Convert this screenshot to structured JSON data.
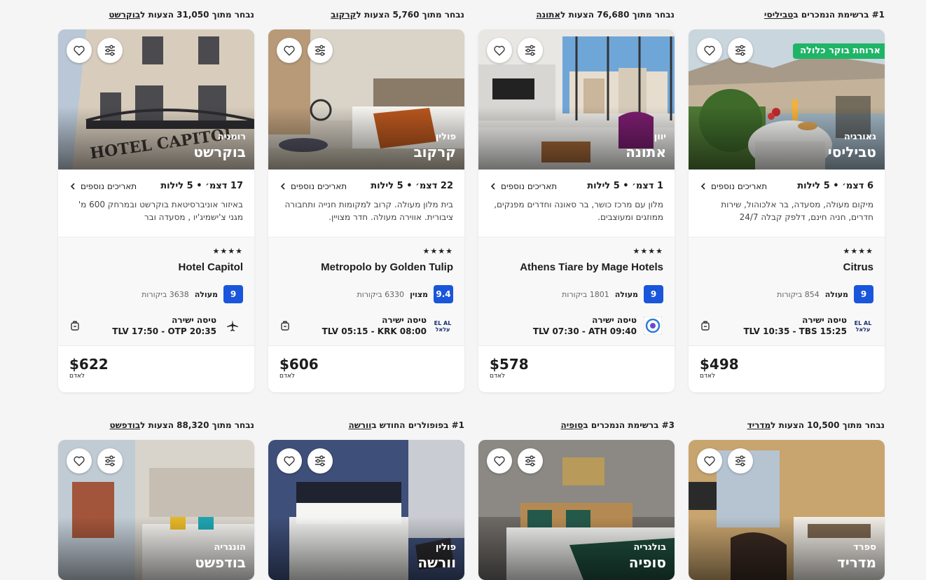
{
  "row1": [
    {
      "tag_prefix": "#1 ברשימת הנמכרים ב",
      "tag_link": "טביליסי",
      "country": "גאורגיה",
      "city": "טביליסי",
      "badge": "ארוחת בוקר כלולה",
      "nights": "6 דצמ׳ • 5 לילות",
      "more_dates": "תאריכים נוספים",
      "description": "מיקום מעולה, מסעדה, בר אלכוהול, שירות חדרים, חניה חינם, דלפק קבלה 24/7",
      "stars": "★★★★",
      "hotel": "Citrus",
      "score": "9",
      "score_label": "מעולה",
      "reviews": "854 ביקורות",
      "flight_type": "טיסה ישירה",
      "flight_times": "TLV 10:35 - TBS 15:25",
      "airline_icon": "elal-logo",
      "price": "$498",
      "per": "לאדם",
      "photo": "terrace"
    },
    {
      "tag_prefix": "נבחר מתוך 76,680 הצעות ל",
      "tag_link": "אתונה",
      "country": "יוון",
      "city": "אתונה",
      "badge": "",
      "nights": "1 דצמ׳ • 5 לילות",
      "more_dates": "תאריכים נוספים",
      "description": "מלון עם מרכז כושר, בר סאונה וחדרים מפנקים, ממוזגים ומעוצבים.",
      "stars": "★★★★",
      "hotel": "Athens Tiare by Mage Hotels",
      "score": "9",
      "score_label": "מעולה",
      "reviews": "1801 ביקורות",
      "flight_type": "טיסה ישירה",
      "flight_times": "TLV 07:30 - ATH 09:40",
      "airline_icon": "bluebird-logo",
      "price": "$578",
      "per": "לאדם",
      "photo": "room-window"
    },
    {
      "tag_prefix": "נבחר מתוך 5,760 הצעות ל",
      "tag_link": "קרקוב",
      "country": "פולין",
      "city": "קרקוב",
      "badge": "",
      "nights": "22 דצמ׳ • 5 לילות",
      "more_dates": "תאריכים נוספים",
      "description": "בית מלון מעולה. קרוב למקומות חנייה ותחבורה ציבורית. אווירה מעולה. חדר מצויין.",
      "stars": "★★★★",
      "hotel": "Metropolo by Golden Tulip",
      "score": "9.4",
      "score_label": "מצוין",
      "reviews": "6330 ביקורות",
      "flight_type": "טיסה ישירה",
      "flight_times": "TLV 05:15 - KRK 08:00",
      "airline_icon": "elal-logo",
      "price": "$606",
      "per": "לאדם",
      "photo": "room-bed"
    },
    {
      "tag_prefix": "נבחר מתוך 31,050 הצעות ל",
      "tag_link": "בוקרשט",
      "country": "רומניה",
      "city": "בוקרשט",
      "badge": "",
      "nights": "17 דצמ׳ • 5 לילות",
      "more_dates": "תאריכים נוספים",
      "description": "באיזור אוניברסיטאת בוקרשט ובמרחק 600 מ' מגני צ'ישמיג'יו , מסעדה ובר",
      "stars": "★★★★",
      "hotel": "Hotel Capitol",
      "score": "9",
      "score_label": "מעולה",
      "reviews": "3638 ביקורות",
      "flight_type": "טיסה ישירה",
      "flight_times": "TLV 17:50 - OTP 20:35",
      "airline_icon": "plane-icon",
      "price": "$622",
      "per": "לאדם",
      "photo": "building"
    }
  ],
  "row2": [
    {
      "tag_prefix": "נבחר מתוך 10,500 הצעות ל",
      "tag_link": "מדריד",
      "country": "ספרד",
      "city": "מדריד",
      "photo": "room-warm"
    },
    {
      "tag_prefix": "#3 ברשימת הנמכרים ב",
      "tag_link": "סופיה",
      "country": "בולגריה",
      "city": "סופיה",
      "photo": "room-green"
    },
    {
      "tag_prefix": "#1 בפופולרים החודש ב",
      "tag_link": "וורשה",
      "country": "פולין",
      "city": "וורשה",
      "photo": "room-blue"
    },
    {
      "tag_prefix": "נבחר מתוך 88,320 הצעות ל",
      "tag_link": "בודפשט",
      "country": "הונגריה",
      "city": "בודפשט",
      "photo": "room-city"
    }
  ],
  "colors": {
    "score_blue": "#1a56db",
    "badge_green": "#1fb567"
  }
}
